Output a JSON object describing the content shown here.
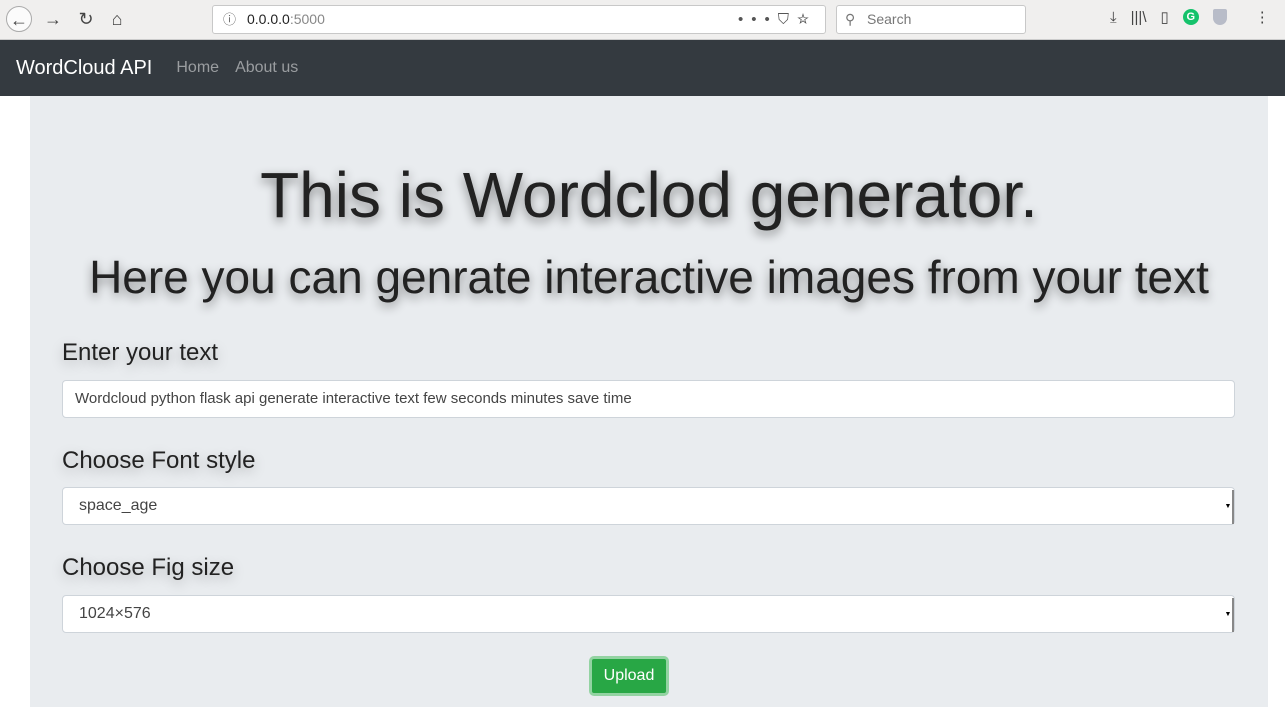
{
  "browser": {
    "url_host": "0.0.0.0",
    "url_port": ":5000",
    "search_placeholder": "Search",
    "icons": [
      "back-icon",
      "forward-icon",
      "reload-icon",
      "home-icon",
      "info-icon",
      "more-icon",
      "pocket-icon",
      "star-icon",
      "search-icon",
      "download-icon",
      "library-icon",
      "sidebar-icon",
      "grammarly-icon",
      "shield-icon",
      "menu-icon"
    ],
    "grammarly_letter": "G"
  },
  "navbar": {
    "brand": "WordCloud API",
    "links": [
      "Home",
      "About us"
    ]
  },
  "main": {
    "title": "This is Wordclod generator.",
    "subtitle": "Here you can genrate interactive images from your text",
    "text_label": "Enter your text",
    "text_value": "Wordcloud python flask api generate interactive text few seconds  minutes  save time",
    "font_label": "Choose Font style",
    "font_value": "space_age",
    "size_label": "Choose Fig size",
    "size_value": "1024×576",
    "upload_label": "Upload"
  },
  "colors": {
    "navbar": "#343a40",
    "jumbotron": "#e9ecef",
    "upload": "#28a745"
  }
}
